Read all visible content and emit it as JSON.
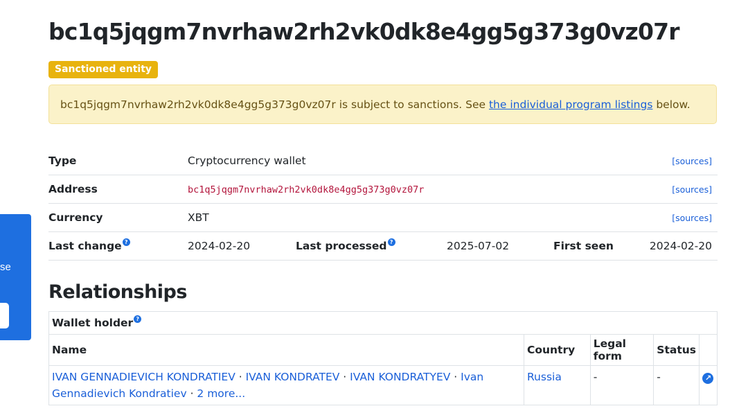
{
  "header": {
    "title": "bc1q5jqgm7nvrhaw2rh2vk0dk8e4gg5g373g0vz07r",
    "badge": "Sanctioned entity"
  },
  "alert": {
    "prefix": "bc1q5jqgm7nvrhaw2rh2vk0dk8e4gg5g373g0vz07r is subject to sanctions. See ",
    "link_text": "the individual program listings",
    "suffix": " below."
  },
  "side_panel": {
    "peek_text": "se"
  },
  "properties": {
    "sources_label": "[sources]",
    "help_glyph": "?",
    "type": {
      "label": "Type",
      "value": "Cryptocurrency wallet"
    },
    "address": {
      "label": "Address",
      "value": "bc1q5jqgm7nvrhaw2rh2vk0dk8e4gg5g373g0vz07r"
    },
    "currency": {
      "label": "Currency",
      "value": "XBT"
    },
    "last_change": {
      "label": "Last change",
      "value": "2024-02-20"
    },
    "last_processed": {
      "label": "Last processed",
      "value": "2025-07-02"
    },
    "first_seen": {
      "label": "First seen",
      "value": "2024-02-20"
    }
  },
  "relationships": {
    "title": "Relationships",
    "group_label": "Wallet holder",
    "columns": [
      "Name",
      "Country",
      "Legal form",
      "Status"
    ],
    "rows": [
      {
        "names": [
          "IVAN GENNADIEVICH KONDRATIEV",
          "IVAN KONDRATEV",
          "IVAN KONDRATYEV",
          "Ivan Gennadievich Kondratiev"
        ],
        "more": "2 more...",
        "country": "Russia",
        "legal_form": "-",
        "status": "-",
        "link_icon": "arrow-up-right-icon"
      }
    ]
  },
  "colors": {
    "accent": "#1e6fe0",
    "badge": "#e8b30e",
    "alert_bg": "#fbf2c9",
    "link": "#1a5fd8"
  }
}
